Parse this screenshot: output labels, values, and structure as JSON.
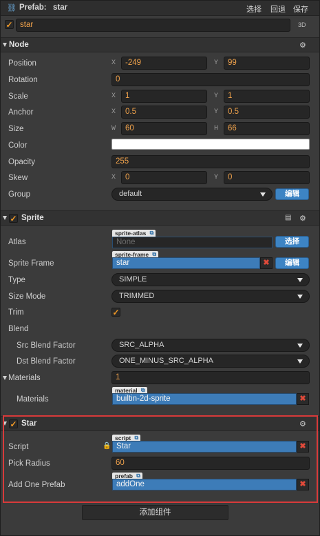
{
  "titlebar": {
    "label": "Prefab:",
    "name": "star",
    "select": "选择",
    "revert": "回退",
    "save": "保存"
  },
  "node_name": {
    "value": "star",
    "badge_3d": "3D"
  },
  "node_section": {
    "title": "Node",
    "position": {
      "label": "Position",
      "x_axis": "X",
      "x": "-249",
      "y_axis": "Y",
      "y": "99"
    },
    "rotation": {
      "label": "Rotation",
      "value": "0"
    },
    "scale": {
      "label": "Scale",
      "x_axis": "X",
      "x": "1",
      "y_axis": "Y",
      "y": "1"
    },
    "anchor": {
      "label": "Anchor",
      "x_axis": "X",
      "x": "0.5",
      "y_axis": "Y",
      "y": "0.5"
    },
    "size": {
      "label": "Size",
      "w_axis": "W",
      "w": "60",
      "h_axis": "H",
      "h": "66"
    },
    "color": {
      "label": "Color",
      "value": "#ffffff"
    },
    "opacity": {
      "label": "Opacity",
      "value": "255"
    },
    "skew": {
      "label": "Skew",
      "x_axis": "X",
      "x": "0",
      "y_axis": "Y",
      "y": "0"
    },
    "group": {
      "label": "Group",
      "value": "default",
      "edit": "编辑"
    }
  },
  "sprite_section": {
    "title": "Sprite",
    "atlas": {
      "label": "Atlas",
      "tag": "sprite-atlas",
      "value": "None",
      "button": "选择"
    },
    "sprite_frame": {
      "label": "Sprite Frame",
      "tag": "sprite-frame",
      "value": "star",
      "button": "编辑"
    },
    "type": {
      "label": "Type",
      "value": "SIMPLE"
    },
    "size_mode": {
      "label": "Size Mode",
      "value": "TRIMMED"
    },
    "trim": {
      "label": "Trim",
      "checked": true
    },
    "blend": {
      "label": "Blend"
    },
    "src_blend": {
      "label": "Src Blend Factor",
      "value": "SRC_ALPHA"
    },
    "dst_blend": {
      "label": "Dst Blend Factor",
      "value": "ONE_MINUS_SRC_ALPHA"
    },
    "materials_count": {
      "label": "Materials",
      "value": "1"
    },
    "materials": {
      "label": "Materials",
      "tag": "material",
      "value": "builtin-2d-sprite"
    }
  },
  "star_section": {
    "title": "Star",
    "script": {
      "label": "Script",
      "tag": "script",
      "value": "Star"
    },
    "pick_radius": {
      "label": "Pick Radius",
      "value": "60"
    },
    "add_one_prefab": {
      "label": "Add One Prefab",
      "tag": "prefab",
      "value": "addOne"
    }
  },
  "add_component": "添加组件",
  "icons": {
    "prefab": "link-icon",
    "gear": "gear-icon",
    "book": "book-icon",
    "lock": "lock-icon",
    "remove": "x-icon"
  },
  "colors": {
    "accent_orange": "#f0a24b",
    "asset_blue": "#3d7cb8",
    "highlight_red": "#d83a3a"
  }
}
